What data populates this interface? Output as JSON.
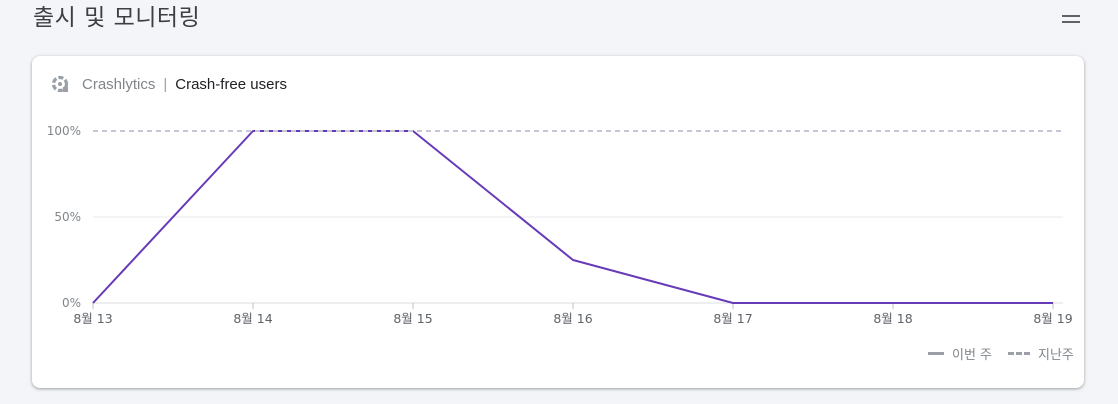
{
  "section": {
    "title": "출시 및 모니터링",
    "menu_icon": "menu-icon"
  },
  "card": {
    "product": "Crashlytics",
    "separator": "|",
    "metric": "Crash-free users",
    "product_icon": "crashlytics-icon"
  },
  "colors": {
    "this_week": "#673ab7",
    "last_week": "#c6c7d6",
    "gridline": "#e8eaed",
    "axis_text": "#80868b"
  },
  "legend": {
    "this_week": "이번 주",
    "last_week": "지난주"
  },
  "chart_data": {
    "type": "line",
    "categories": [
      "8월 13",
      "8월 14",
      "8월 15",
      "8월 16",
      "8월 17",
      "8월 18",
      "8월 19"
    ],
    "series": [
      {
        "name": "이번 주",
        "values": [
          0,
          100,
          100,
          25,
          0,
          0,
          0
        ],
        "style": "solid"
      },
      {
        "name": "지난주",
        "values": [
          100,
          100,
          100,
          100,
          100,
          100,
          100
        ],
        "style": "dashed"
      }
    ],
    "yticks": [
      "0%",
      "50%",
      "100%"
    ],
    "ytick_values": [
      0,
      50,
      100
    ],
    "ylim": [
      0,
      100
    ],
    "title": "",
    "xlabel": "",
    "ylabel": "",
    "grid": true,
    "legend_position": "bottom-right"
  }
}
